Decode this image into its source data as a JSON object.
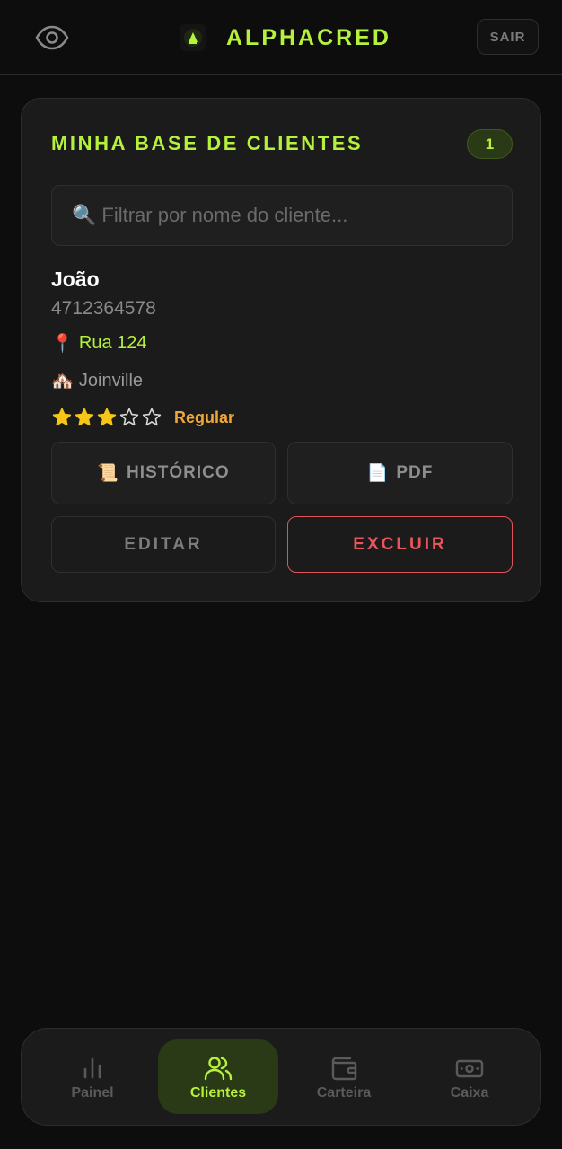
{
  "header": {
    "brand": "ALPHACRED",
    "logout_label": "SAIR"
  },
  "clients": {
    "title": "MINHA BASE DE CLIENTES",
    "count": "1",
    "search_placeholder": "Filtrar por nome do cliente...",
    "search_value": "",
    "items": [
      {
        "name": "João",
        "document": "4712364578",
        "address": "Rua 124",
        "city": "Joinville",
        "rating": 3,
        "rating_max": 5,
        "rating_label": "Regular"
      }
    ],
    "actions": {
      "history_label": "HISTÓRICO",
      "pdf_label": "PDF",
      "edit_label": "EDITAR",
      "delete_label": "EXCLUIR"
    }
  },
  "nav": {
    "items": [
      {
        "label": "Painel",
        "icon": "bar-chart-icon"
      },
      {
        "label": "Clientes",
        "icon": "users-icon"
      },
      {
        "label": "Carteira",
        "icon": "wallet-icon"
      },
      {
        "label": "Caixa",
        "icon": "cash-icon"
      }
    ],
    "active": "Clientes"
  },
  "colors": {
    "accent": "#b6f23c",
    "danger": "#e8555c",
    "rating": "#f0a73a",
    "star": "#f5c518"
  }
}
